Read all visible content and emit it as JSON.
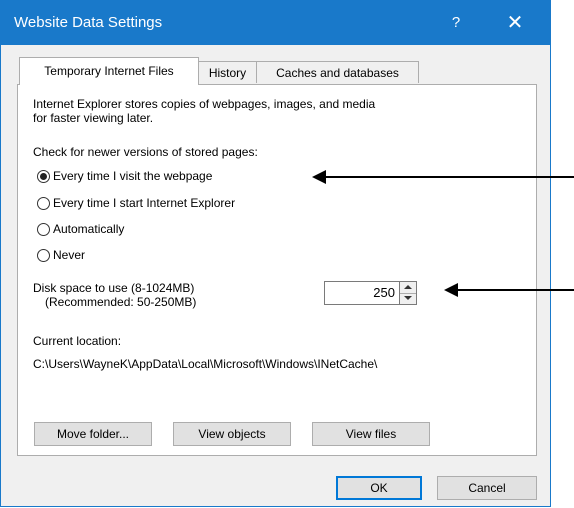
{
  "dialog": {
    "title": "Website Data Settings",
    "help_symbol": "?",
    "close_symbol": "✕"
  },
  "tabs": [
    {
      "label": "Temporary Internet Files",
      "active": true
    },
    {
      "label": "History",
      "active": false
    },
    {
      "label": "Caches and databases",
      "active": false
    }
  ],
  "temp_files": {
    "description_line1": "Internet Explorer stores copies of webpages, images, and media",
    "description_line2": "for faster viewing later.",
    "check_label": "Check for newer versions of stored pages:",
    "options": [
      {
        "label": "Every time I visit the webpage",
        "selected": true
      },
      {
        "label": "Every time I start Internet Explorer",
        "selected": false
      },
      {
        "label": "Automatically",
        "selected": false
      },
      {
        "label": "Never",
        "selected": false
      }
    ],
    "disk_label_line1": "Disk space to use (8-1024MB)",
    "disk_label_line2": "(Recommended: 50-250MB)",
    "disk_value": "250",
    "location_label": "Current location:",
    "location_path": "C:\\Users\\WayneK\\AppData\\Local\\Microsoft\\Windows\\INetCache\\",
    "buttons": {
      "move_folder": "Move folder...",
      "view_objects": "View objects",
      "view_files": "View files"
    }
  },
  "footer": {
    "ok": "OK",
    "cancel": "Cancel"
  },
  "colors": {
    "titlebar": "#1979ca",
    "default_button_border": "#0078d7"
  }
}
